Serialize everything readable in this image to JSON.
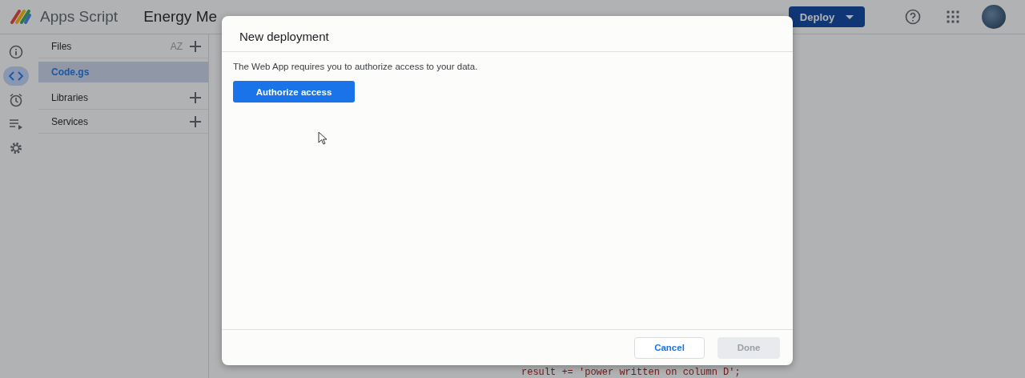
{
  "app": {
    "name": "Apps Script",
    "project": "Energy Me"
  },
  "header": {
    "deploy_button": "Deploy"
  },
  "sidebar_icons": [
    {
      "kind": "info",
      "selected": false
    },
    {
      "kind": "code",
      "selected": true
    },
    {
      "kind": "clock",
      "selected": false
    },
    {
      "kind": "runs",
      "selected": false
    },
    {
      "kind": "settings",
      "selected": false
    }
  ],
  "files_panel": {
    "title": "Files",
    "sort_button": "AZ",
    "files": [
      {
        "name": "Code.gs",
        "selected": true
      }
    ],
    "sections": [
      {
        "label": "Libraries"
      },
      {
        "label": "Services"
      }
    ]
  },
  "editor": {
    "lines": [
      "result += 'power written on column D';"
    ]
  },
  "dialog": {
    "title": "New deployment",
    "message": "The Web App requires you to authorize access to your data.",
    "authorize_button": "Authorize access",
    "cancel_button": "Cancel",
    "done_button": {
      "label": "Done",
      "disabled": true
    }
  }
}
